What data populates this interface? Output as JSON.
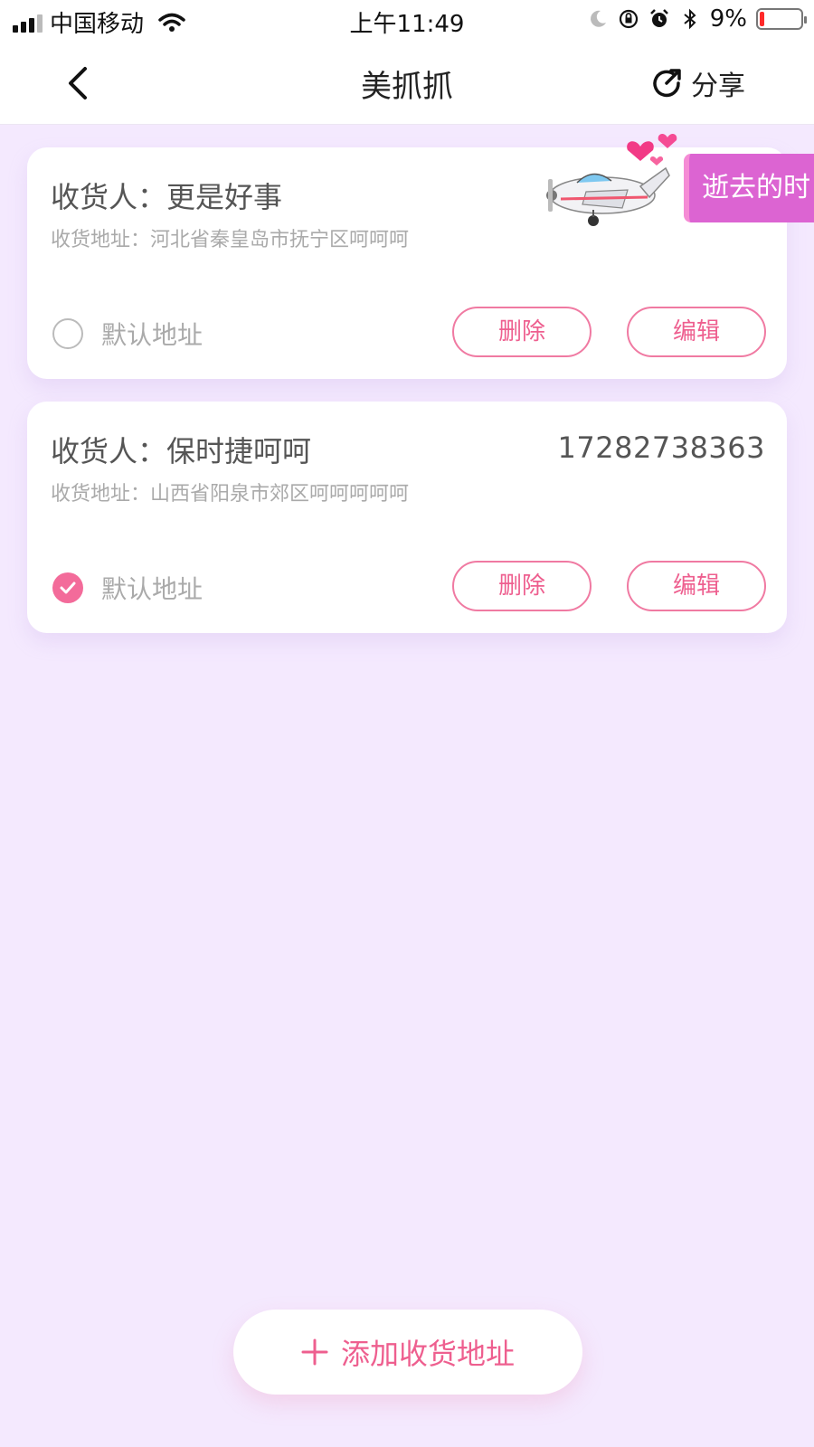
{
  "status_bar": {
    "carrier": "中国移动",
    "time": "上午11:49",
    "battery_percent": "9%",
    "icons": [
      "signal-icon",
      "wifi-icon",
      "moon-icon",
      "rotation-lock-icon",
      "alarm-icon",
      "bluetooth-icon",
      "battery-icon"
    ]
  },
  "nav": {
    "title": "美抓抓",
    "share_label": "分享",
    "back_icon": "back-chevron-icon",
    "share_icon": "share-icon"
  },
  "addresses": [
    {
      "recipient": "收货人：更是好事",
      "phone": "",
      "address": "收货地址：河北省秦皇岛市抚宁区呵呵呵",
      "default_label": "默认地址",
      "is_default": false,
      "delete_label": "删除",
      "edit_label": "编辑"
    },
    {
      "recipient": "收货人：保时捷呵呵",
      "phone": "17282738363",
      "address": "收货地址：山西省阳泉市郊区呵呵呵呵呵",
      "default_label": "默认地址",
      "is_default": true,
      "delete_label": "删除",
      "edit_label": "编辑"
    }
  ],
  "floating_banner": {
    "text": "逝去的时"
  },
  "add_button": {
    "label": "添加收货地址"
  },
  "colors": {
    "accent": "#ee5f8f",
    "background": "#f4e9fe",
    "banner": "#dc64d2"
  }
}
